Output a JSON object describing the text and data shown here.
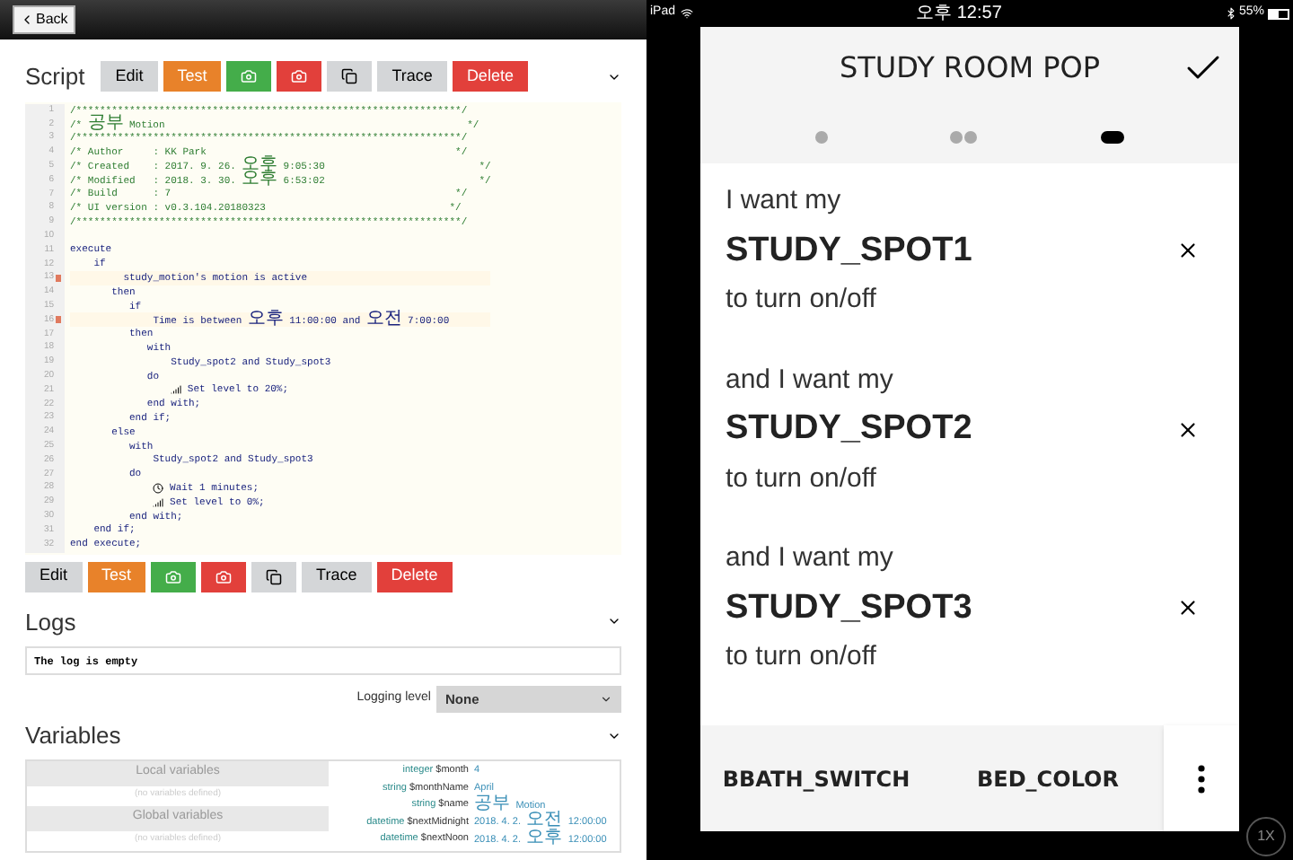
{
  "back_button": {
    "label": "Back"
  },
  "script": {
    "title": "Script",
    "toolbar": [
      {
        "kind": "text",
        "label": "Edit",
        "color": "#d4d6d8"
      },
      {
        "kind": "text",
        "label": "Test",
        "color": "#e8822a"
      },
      {
        "kind": "camera",
        "color": "#44ad4a"
      },
      {
        "kind": "camera",
        "color": "#e2403b"
      },
      {
        "kind": "copy",
        "color": "#d4d6d8"
      },
      {
        "kind": "text",
        "label": "Trace",
        "color": "#d4d6d8"
      },
      {
        "kind": "text",
        "label": "Delete",
        "color": "#e2403b"
      }
    ],
    "bottom_toolbar": [
      {
        "kind": "text",
        "label": "Edit",
        "color": "#d4d6d8"
      },
      {
        "kind": "text",
        "label": "Test",
        "color": "#e8822a"
      },
      {
        "kind": "camera",
        "color": "#44ad4a"
      },
      {
        "kind": "camera",
        "color": "#e2403b"
      },
      {
        "kind": "copy",
        "color": "#d4d6d8"
      },
      {
        "kind": "text",
        "label": "Trace",
        "color": "#d4d6d8"
      },
      {
        "kind": "text",
        "label": "Delete",
        "color": "#e2403b"
      }
    ],
    "line_numbers": [
      "1",
      "2",
      "3",
      "4",
      "5",
      "6",
      "7",
      "8",
      "9",
      "10",
      "11",
      "12",
      "13",
      "14",
      "15",
      "16",
      "17",
      "18",
      "19",
      "20",
      "21",
      "22",
      "23",
      "24",
      "25",
      "26",
      "27",
      "28",
      "29",
      "30",
      "31",
      "32"
    ],
    "code": [
      {
        "kind": "comment",
        "text": "/*****************************************************************/",
        "marked": false
      },
      {
        "kind": "comment",
        "text": "/* 공부 Motion                                                   */",
        "marked": false
      },
      {
        "kind": "comment",
        "text": "/*****************************************************************/",
        "marked": false
      },
      {
        "kind": "comment",
        "text": "/* Author     : KK Park                                          */",
        "marked": false
      },
      {
        "kind": "comment",
        "text": "/* Created    : 2017. 9. 26. 오후 9:05:30                          */",
        "marked": false
      },
      {
        "kind": "comment",
        "text": "/* Modified   : 2018. 3. 30. 오후 6:53:02                          */",
        "marked": false
      },
      {
        "kind": "comment",
        "text": "/* Build      : 7                                                */",
        "marked": false
      },
      {
        "kind": "comment",
        "text": "/* UI version : v0.3.104.20180323                               */",
        "marked": false
      },
      {
        "kind": "comment",
        "text": "/*****************************************************************/",
        "marked": false
      },
      {
        "kind": "code",
        "marked": false
      },
      {
        "kind": "code",
        "text": "execute",
        "marked": false
      },
      {
        "kind": "code",
        "text": "    if",
        "marked": false
      },
      {
        "kind": "code",
        "text": "         study_motion's motion is active",
        "marked": true
      },
      {
        "kind": "code",
        "text": "       then",
        "marked": false
      },
      {
        "kind": "code",
        "text": "          if",
        "marked": false
      },
      {
        "kind": "code",
        "text": "              Time is between 오후 11:00:00 and 오전 7:00:00",
        "marked": true
      },
      {
        "kind": "code",
        "text": "          then",
        "marked": false
      },
      {
        "kind": "code",
        "text": "             with",
        "marked": false
      },
      {
        "kind": "code",
        "text": "                 Study_spot2 and Study_spot3",
        "marked": false
      },
      {
        "kind": "code",
        "text": "             do",
        "marked": false
      },
      {
        "kind": "level",
        "text": "                 Set level to 20%;",
        "marked": false
      },
      {
        "kind": "code",
        "text": "             end with;",
        "marked": false
      },
      {
        "kind": "code",
        "text": "          end if;",
        "marked": false
      },
      {
        "kind": "code",
        "text": "       else",
        "marked": false
      },
      {
        "kind": "code",
        "text": "          with",
        "marked": false
      },
      {
        "kind": "code",
        "text": "              Study_spot2 and Study_spot3",
        "marked": false
      },
      {
        "kind": "code",
        "text": "          do",
        "marked": false
      },
      {
        "kind": "wait",
        "text": "              Wait 1 minutes;",
        "marked": false
      },
      {
        "kind": "level",
        "text": "              Set level to 0%;",
        "marked": false
      },
      {
        "kind": "code",
        "text": "          end with;",
        "marked": false
      },
      {
        "kind": "code",
        "text": "    end if;",
        "marked": false
      },
      {
        "kind": "code",
        "text": "end execute;",
        "marked": false
      }
    ]
  },
  "logs": {
    "title": "Logs",
    "content": "The log is empty",
    "logging_level_label": "Logging level",
    "logging_level": "None"
  },
  "variables": {
    "title": "Variables",
    "left": [
      {
        "kind": "header",
        "text": "Local variables"
      },
      {
        "kind": "empty",
        "text": "(no variables defined)"
      },
      {
        "kind": "header",
        "text": "Global variables"
      },
      {
        "kind": "empty",
        "text": "(no variables defined)"
      }
    ],
    "rows": [
      {
        "type": "integer",
        "name": "$month",
        "value": "4"
      },
      {
        "type": "string",
        "name": "$monthName",
        "value": "April"
      },
      {
        "type": "string",
        "name": "$name",
        "value": "공부 Motion"
      },
      {
        "type": "datetime",
        "name": "$nextMidnight",
        "value": "2018. 4. 2. 오전 12:00:00"
      },
      {
        "type": "datetime",
        "name": "$nextNoon",
        "value": "2018. 4. 2. 오후 12:00:00"
      }
    ]
  },
  "status_bar": {
    "device": "iPad",
    "time": "오후 12:57",
    "battery": "55%"
  },
  "dialog": {
    "title": "STUDY ROOM POP",
    "steps": [
      {
        "kind": "single",
        "selected": false
      },
      {
        "kind": "double",
        "selected": false
      },
      {
        "selected": true
      }
    ],
    "items": [
      {
        "prefix": "I want my",
        "device": "STUDY_SPOT1",
        "suffix": "to turn on/off"
      },
      {
        "prefix": "and I want my",
        "device": "STUDY_SPOT2",
        "suffix": "to turn on/off"
      },
      {
        "prefix": "and I want my",
        "device": "STUDY_SPOT3",
        "suffix": "to turn on/off"
      }
    ],
    "bottom_tabs": [
      "BBATH_SWITCH",
      "BED_COLOR"
    ]
  },
  "zoom_badge": "1X"
}
